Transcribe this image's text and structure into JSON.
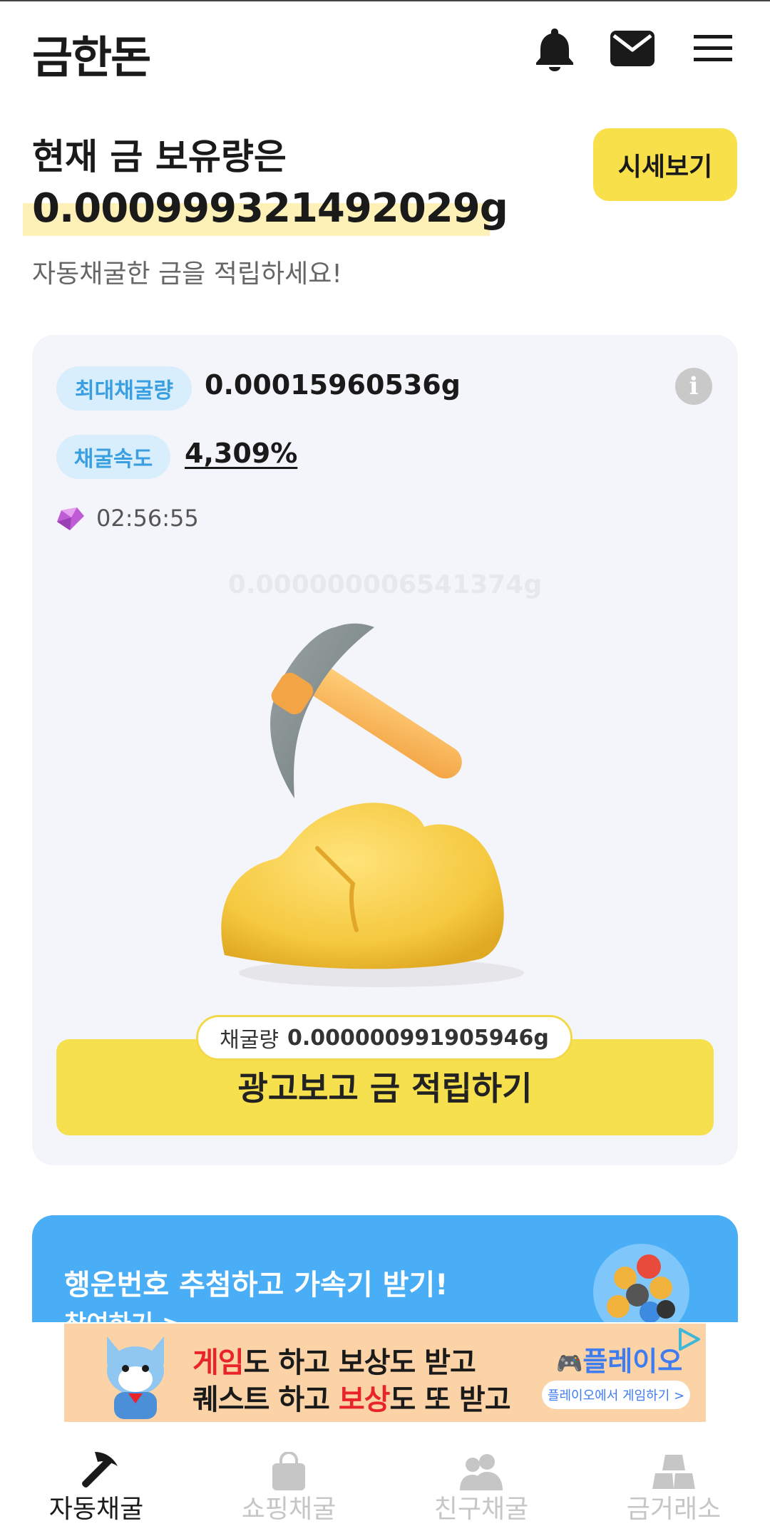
{
  "header": {
    "logo": "금한돈",
    "icons": [
      "bell-icon",
      "mail-icon",
      "menu-icon"
    ]
  },
  "hero": {
    "title": "현재 금 보유량은",
    "value": "0.000999321492029g",
    "subtitle": "자동채굴한 금을 적립하세요!",
    "price_button": "시세보기"
  },
  "mining": {
    "max_label": "최대채굴량",
    "max_value": "0.00015960536g",
    "speed_label": "채굴속도",
    "speed_value": "4,309%",
    "timer": "02:56:55",
    "ghost_value": "0.000000006541374g",
    "amount_label": "채굴량",
    "amount_value": "0.000000991905946g",
    "action_button": "광고보고 금 적립하기"
  },
  "lucky": {
    "title": "행운번호 추첨하고 가속기 받기!",
    "link": "참여하기"
  },
  "ad": {
    "line1_red": "게임",
    "line1_rest": "도 하고 보상도 받고",
    "line2_a": "퀘스트 하고 ",
    "line2_red": "보상",
    "line2_b": "도 또 받고",
    "brand": "플레이오",
    "cta": "플레이오에서 게임하기 >"
  },
  "nav": {
    "items": [
      {
        "label": "자동채굴",
        "icon": "pickaxe-icon",
        "active": true
      },
      {
        "label": "쇼핑채굴",
        "icon": "shopping-bag-icon",
        "active": false
      },
      {
        "label": "친구채굴",
        "icon": "friends-icon",
        "active": false
      },
      {
        "label": "금거래소",
        "icon": "gold-bars-icon",
        "active": false
      }
    ]
  },
  "colors": {
    "accent_yellow": "#f6e04d",
    "pill_bg": "#d9eefc",
    "pill_text": "#3a9fe0",
    "banner_blue": "#4aaef7",
    "card_bg": "#f4f5fa"
  }
}
